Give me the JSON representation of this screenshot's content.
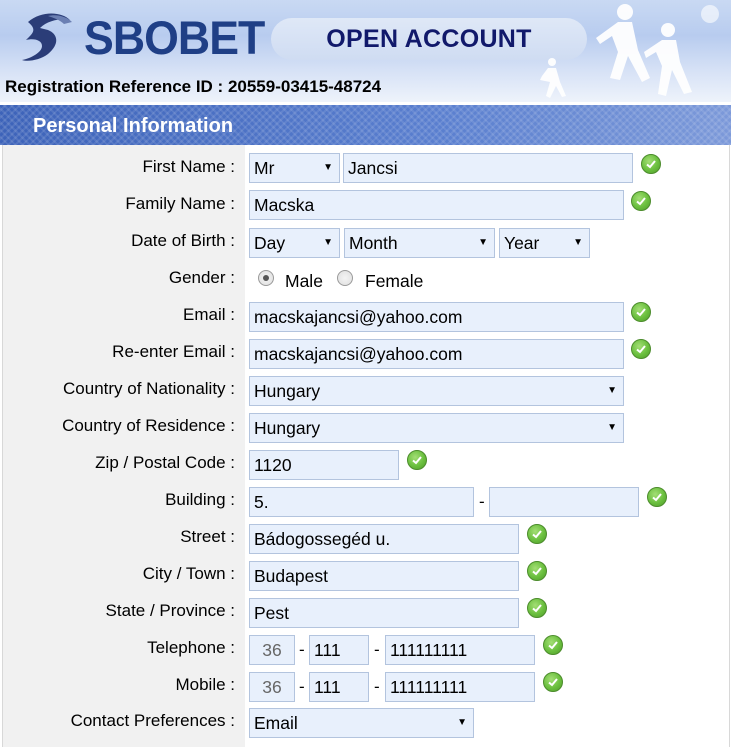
{
  "brand": {
    "logo_text": "SBOBET",
    "accent_color": "#1f3f86"
  },
  "header": {
    "title": "OPEN ACCOUNT",
    "reference": "Registration Reference ID : 20559-03415-48724"
  },
  "section": {
    "title": "Personal Information"
  },
  "form": {
    "first_name": {
      "label": "First Name :",
      "title_value": "Mr",
      "value": "Jancsi"
    },
    "family_name": {
      "label": "Family Name :",
      "value": "Macska"
    },
    "dob": {
      "label": "Date of Birth :",
      "day": "Day",
      "month": "Month",
      "year": "Year"
    },
    "gender": {
      "label": "Gender :",
      "male": "Male",
      "female": "Female",
      "selected": "Male"
    },
    "email": {
      "label": "Email :",
      "value": "macskajancsi@yahoo.com"
    },
    "reenter_email": {
      "label": "Re-enter Email :",
      "value": "macskajancsi@yahoo.com"
    },
    "nationality": {
      "label": "Country of Nationality :",
      "value": "Hungary"
    },
    "residence": {
      "label": "Country of Residence :",
      "value": "Hungary"
    },
    "zip": {
      "label": "Zip / Postal Code :",
      "value": "1120"
    },
    "building": {
      "label": "Building :",
      "value1": "5.",
      "value2": ""
    },
    "street": {
      "label": "Street :",
      "value": "Bádogossegéd u."
    },
    "city": {
      "label": "City / Town :",
      "value": "Budapest"
    },
    "state": {
      "label": "State / Province :",
      "value": "Pest"
    },
    "telephone": {
      "label": "Telephone :",
      "country_code": "36",
      "area_code": "111",
      "number": "111111111"
    },
    "mobile": {
      "label": "Mobile :",
      "country_code": "36",
      "area_code": "111",
      "number": "111111111"
    },
    "contact_pref": {
      "label": "Contact Preferences :",
      "value": "Email"
    },
    "separator": "-"
  },
  "icons": {
    "valid": "check-circle-icon",
    "dropdown": "caret-down-icon"
  }
}
